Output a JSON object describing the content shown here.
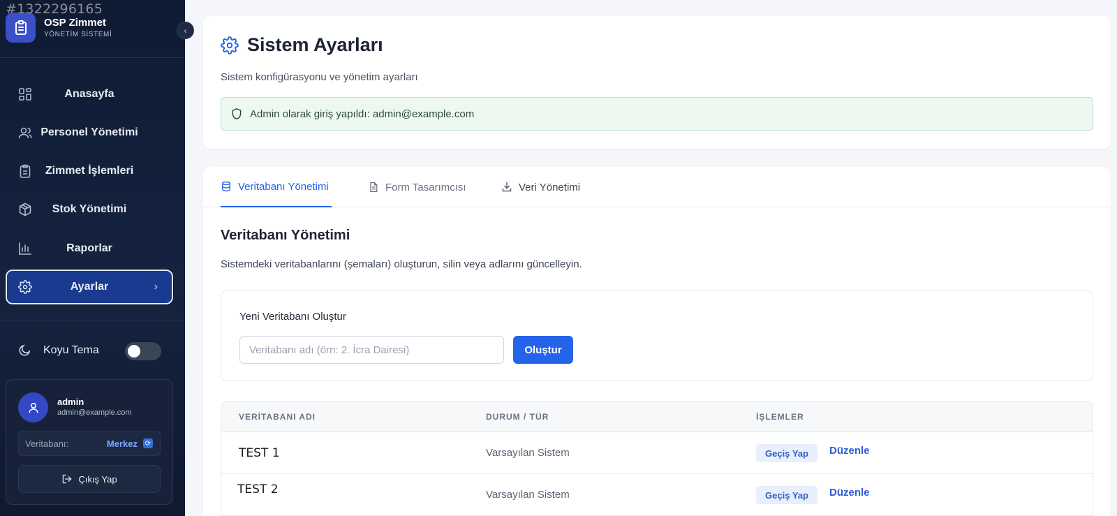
{
  "watermark": "#1322296165",
  "brand": {
    "title": "OSP Zimmet",
    "subtitle": "YÖNETİM SİSTEMİ"
  },
  "sidebar": {
    "items": [
      {
        "label": "Anasayfa",
        "icon": "grid-icon"
      },
      {
        "label": "Personel Yönetimi",
        "icon": "users-icon"
      },
      {
        "label": "Zimmet İşlemleri",
        "icon": "clipboard-icon"
      },
      {
        "label": "Stok Yönetimi",
        "icon": "box-icon"
      },
      {
        "label": "Raporlar",
        "icon": "bar-chart-icon"
      },
      {
        "label": "Ayarlar",
        "icon": "gear-icon",
        "active": true
      }
    ],
    "theme_label": "Koyu Tema"
  },
  "user": {
    "name": "admin",
    "email": "admin@example.com",
    "db_label": "Veritabanı:",
    "db_value": "Merkez",
    "logout_label": "Çıkış Yap"
  },
  "header": {
    "title": "Sistem Ayarları",
    "subtitle": "Sistem konfigürasyonu ve yönetim ayarları",
    "alert": "Admin olarak giriş yapıldı: admin@example.com"
  },
  "tabs": [
    {
      "label": "Veritabanı Yönetimi",
      "active": true
    },
    {
      "label": "Form Tasarımcısı"
    },
    {
      "label": "Veri Yönetimi"
    }
  ],
  "section": {
    "title": "Veritabanı Yönetimi",
    "description": "Sistemdeki veritabanlarını (şemaları) oluşturun, silin veya adlarını güncelleyin."
  },
  "create": {
    "title": "Yeni Veritabanı Oluştur",
    "placeholder": "Veritabanı adı (örn: 2. İcra Dairesi)",
    "button": "Oluştur"
  },
  "table": {
    "headers": [
      "VERİTABANI ADI",
      "DURUM / TÜR",
      "İŞLEMLER"
    ],
    "rows": [
      {
        "name": "TEST 1",
        "status": "Varsayılan Sistem",
        "switch": "Geçiş Yap",
        "edit": "Düzenle"
      },
      {
        "name": "TEST 2",
        "status": "Varsayılan Sistem",
        "switch": "Geçiş Yap",
        "edit": "Düzenle"
      }
    ]
  },
  "colors": {
    "accent": "#2563eb",
    "sidebar_bg": "#0f1b33",
    "active_nav": "#1a3a8f",
    "alert_bg": "#edf8f1"
  }
}
